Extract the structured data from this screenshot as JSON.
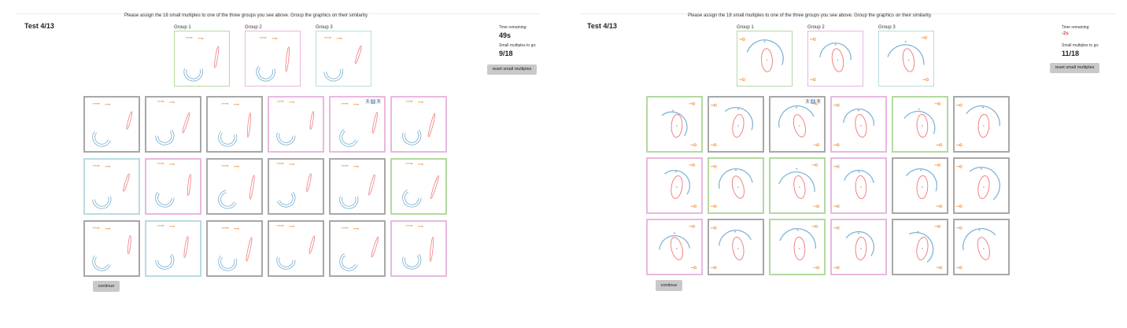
{
  "panels": [
    {
      "instruction": "Please assign the 18 small multiples to one of the three groups you see above. Group the graphics on their similarity.",
      "test_title": "Test 4/13",
      "groups": [
        {
          "label": "Group 1",
          "color": "#b3d9a0"
        },
        {
          "label": "Group 2",
          "color": "#e8b8e0"
        },
        {
          "label": "Group 3",
          "color": "#b8dce0"
        }
      ],
      "time_label": "Time remaining:",
      "time_value": "49s",
      "remaining_label": "Small multiples to go:",
      "remaining_value": "9/18",
      "reset_label": "reset small multiples",
      "continue_label": "continue",
      "group_selector": [
        "1",
        "2",
        "3"
      ],
      "cell_borders": [
        "#a8a8a8",
        "#a8a8a8",
        "#a8a8a8",
        "#e8b8e0",
        "#e8b8e0",
        "#e8b8e0",
        "#b8dce0",
        "#e8b8e0",
        "#a8a8a8",
        "#a8a8a8",
        "#a8a8a8",
        "#b3d9a0",
        "#a8a8a8",
        "#b8dce0",
        "#a8a8a8",
        "#a8a8a8",
        "#a8a8a8",
        "#e8b8e0"
      ]
    },
    {
      "instruction": "Please assign the 18 small multiples to one of the three groups you see above. Group the graphics on their similarity.",
      "test_title": "Test 4/13",
      "groups": [
        {
          "label": "Group 1",
          "color": "#b3d9a0"
        },
        {
          "label": "Group 2",
          "color": "#e8b8e0"
        },
        {
          "label": "Group 3",
          "color": "#b8dce0"
        }
      ],
      "time_label": "Time remaining:",
      "time_value": "-2s",
      "time_value_color": "#e04040",
      "remaining_label": "Small multiples to go:",
      "remaining_value": "11/18",
      "reset_label": "reset small multiples",
      "continue_label": "continue",
      "group_selector": [
        "1",
        "2",
        "3"
      ],
      "cell_borders": [
        "#b3d9a0",
        "#a8a8a8",
        "#a8a8a8",
        "#e8b8e0",
        "#b3d9a0",
        "#a8a8a8",
        "#e8b8e0",
        "#b3d9a0",
        "#b3d9a0",
        "#e8b8e0",
        "#a8a8a8",
        "#a8a8a8",
        "#e8b8e0",
        "#a8a8a8",
        "#b3d9a0",
        "#e8b8e0",
        "#a8a8a8",
        "#a8a8a8"
      ]
    }
  ],
  "colors": {
    "orange": "#f4a460",
    "blue": "#7fb3d5",
    "red": "#f08080",
    "button": "#c9c9c9"
  }
}
